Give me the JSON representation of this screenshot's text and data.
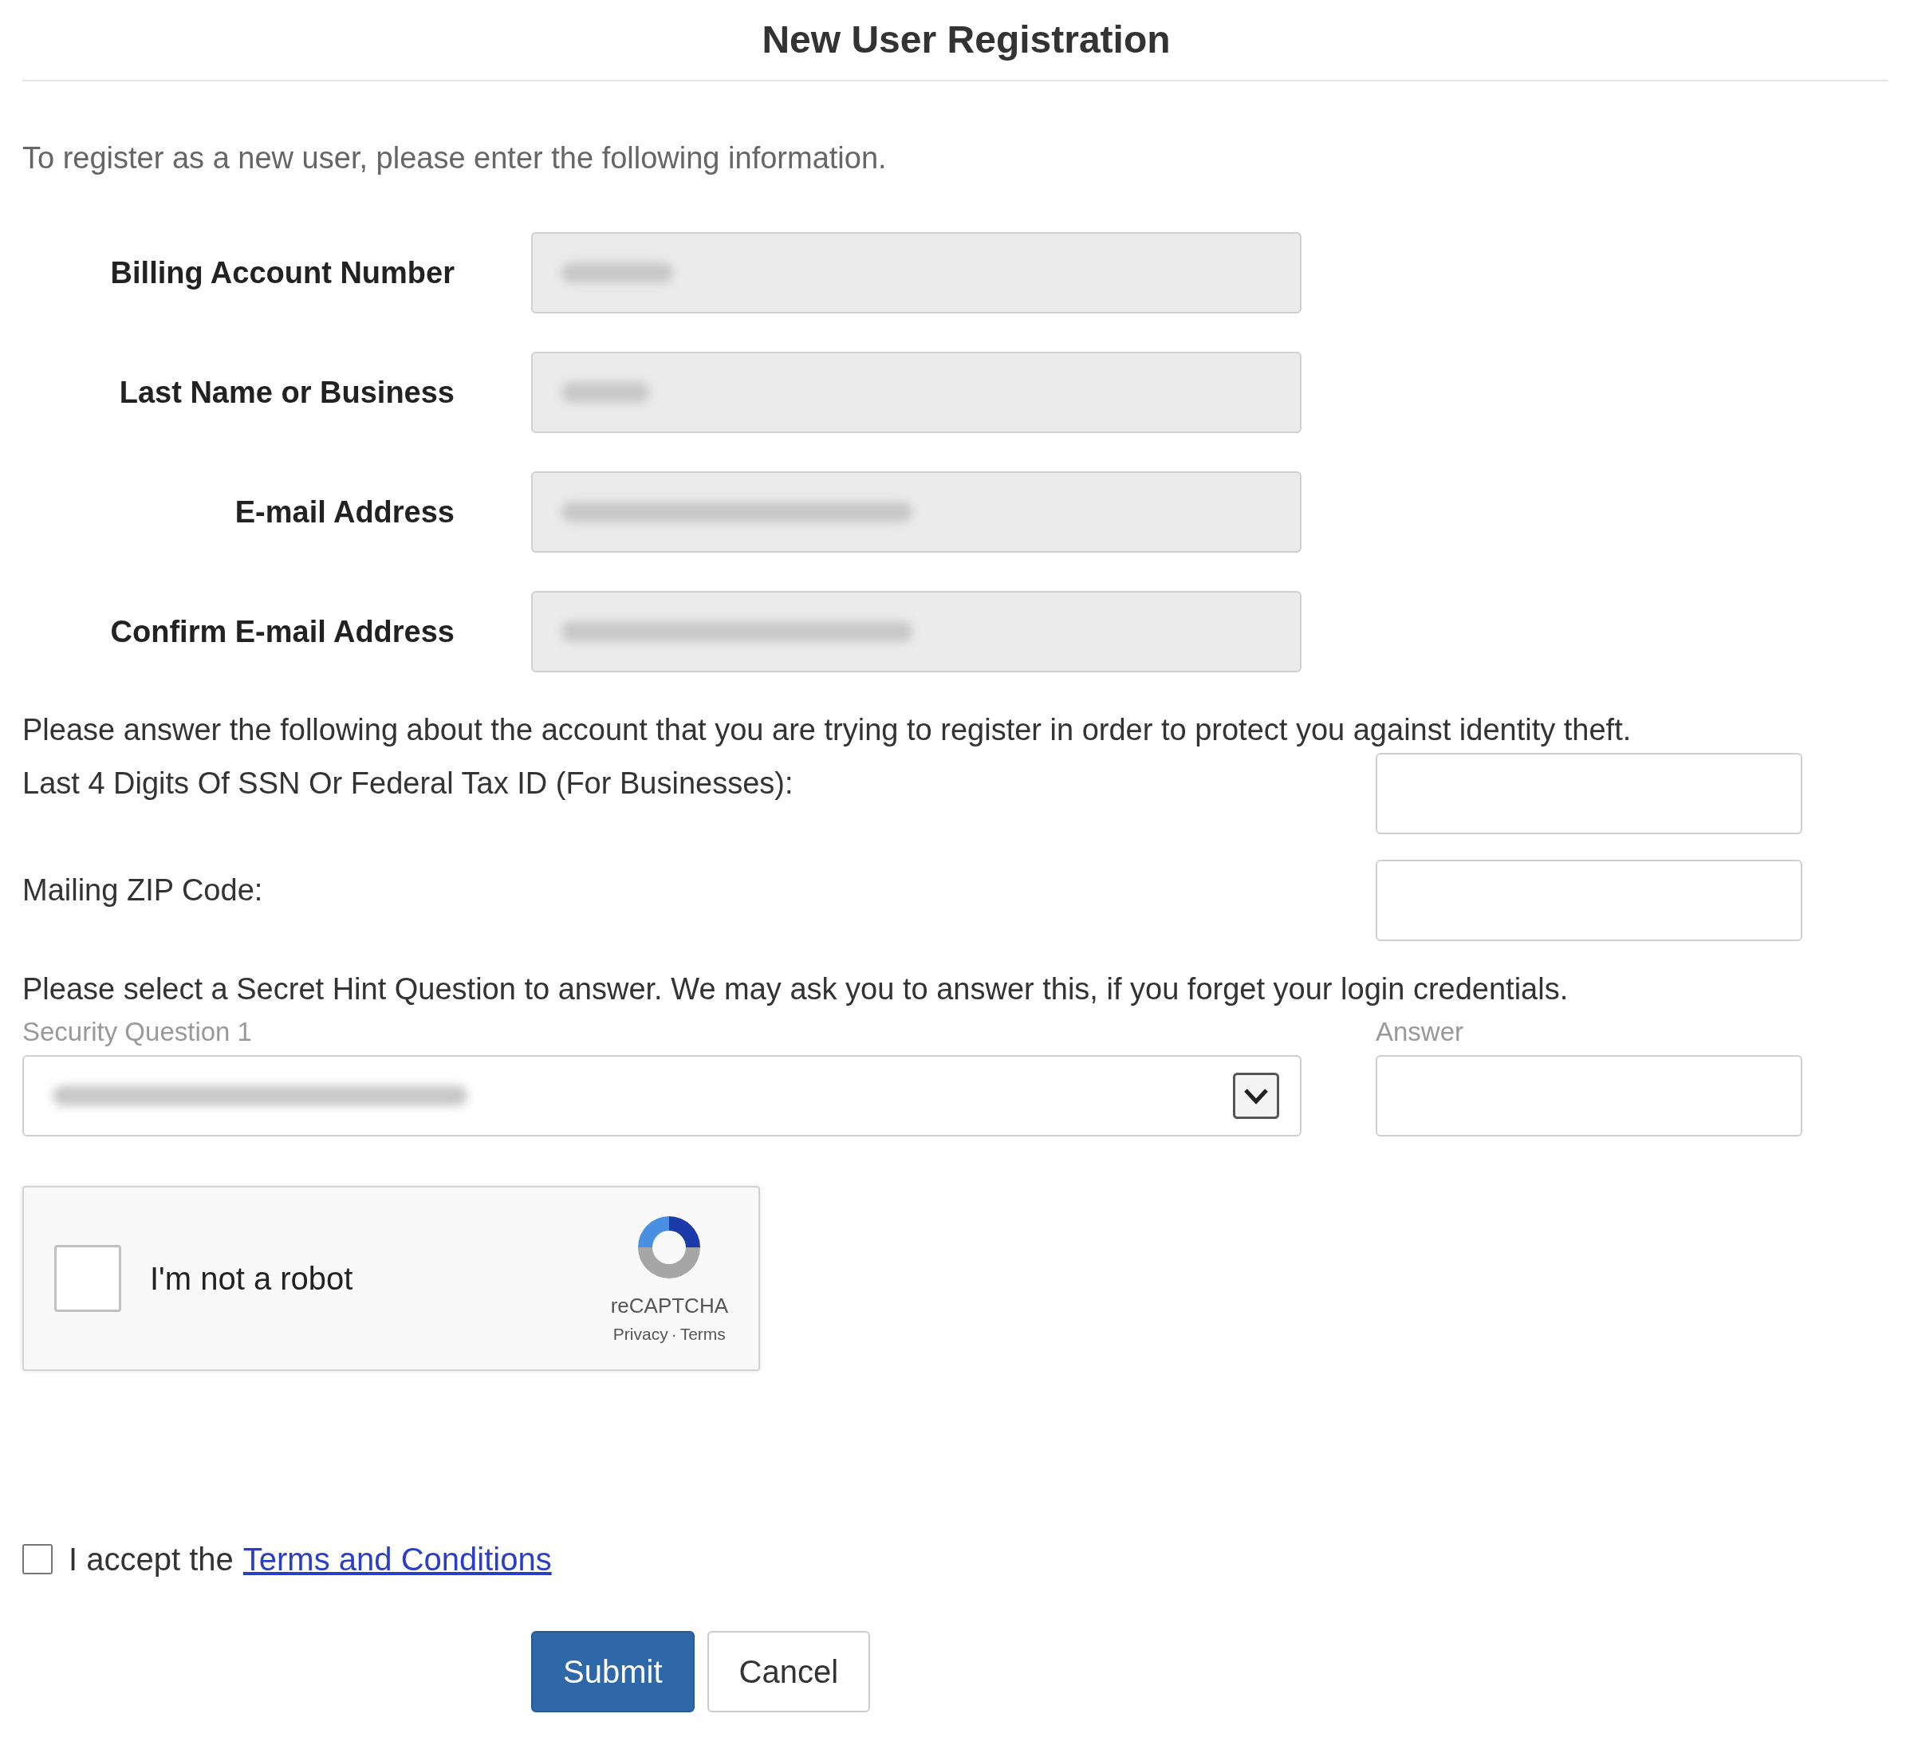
{
  "title": "New User Registration",
  "intro": "To register as a new user, please enter the following information.",
  "account_fields": [
    {
      "label": "Billing Account Number",
      "redacted": true
    },
    {
      "label": "Last Name or Business",
      "redacted": true
    },
    {
      "label": "E-mail Address",
      "redacted": true
    },
    {
      "label": "Confirm E-mail Address",
      "redacted": true
    }
  ],
  "verify_text": "Please answer the following about the account that you are trying to register in order to protect you against identity theft.",
  "verify_fields": [
    {
      "label": "Last 4 Digits Of SSN Or Federal Tax ID (For Businesses):"
    },
    {
      "label": "Mailing ZIP Code:"
    }
  ],
  "hint_text": "Please select a Secret Hint Question to answer. We may ask you to answer this, if you forget your login credentials.",
  "security_question": {
    "label": "Security Question 1",
    "redacted": true
  },
  "answer": {
    "label": "Answer"
  },
  "captcha": {
    "label": "I'm not a robot",
    "checked": false,
    "brand": "reCAPTCHA",
    "privacy": "Privacy",
    "separator": "·",
    "terms": "Terms"
  },
  "terms": {
    "prefix": "I accept the",
    "link": "Terms and Conditions",
    "checked": false
  },
  "buttons": [
    {
      "label": "Submit",
      "kind": "primary"
    },
    {
      "label": "Cancel",
      "kind": "secondary"
    }
  ]
}
